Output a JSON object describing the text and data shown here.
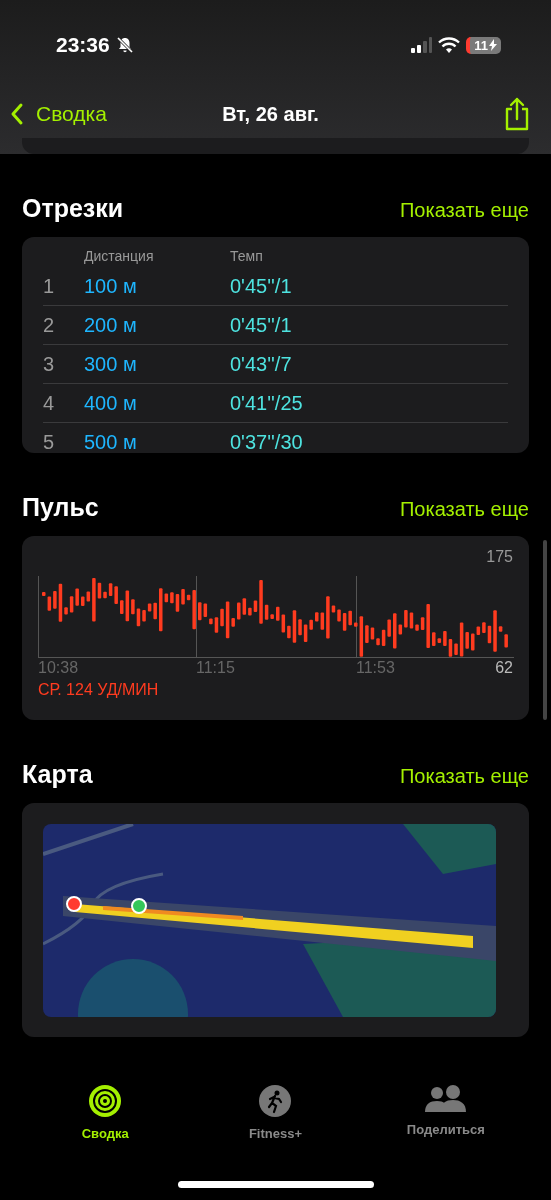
{
  "status_bar": {
    "time": "23:36",
    "silent": true,
    "battery": "11"
  },
  "nav": {
    "back": "Сводка",
    "title": "Вт, 26 авг."
  },
  "splits": {
    "title": "Отрезки",
    "more": "Показать еще",
    "columns": [
      "Дистанция",
      "Темп"
    ],
    "rows": [
      {
        "index": "1",
        "distance": "100 м",
        "pace": "0'45''/1"
      },
      {
        "index": "2",
        "distance": "200 м",
        "pace": "0'45''/1"
      },
      {
        "index": "3",
        "distance": "300 м",
        "pace": "0'43''/7"
      },
      {
        "index": "4",
        "distance": "400 м",
        "pace": "0'41''/25"
      },
      {
        "index": "5",
        "distance": "500 м",
        "pace": "0'37''/30"
      }
    ]
  },
  "heart_rate": {
    "title": "Пульс",
    "more": "Показать еще",
    "max_label": "175",
    "min_label": "62",
    "times": [
      "10:38",
      "11:15",
      "11:53"
    ],
    "average": "СР. 124 УД/МИН"
  },
  "map": {
    "title": "Карта",
    "more": "Показать еще"
  },
  "tab_bar": [
    {
      "label": "Сводка",
      "kind": "rings",
      "selected": true
    },
    {
      "label": "Fitness+",
      "kind": "runner",
      "selected": false
    },
    {
      "label": "Поделиться",
      "kind": "people",
      "selected": false
    }
  ]
}
